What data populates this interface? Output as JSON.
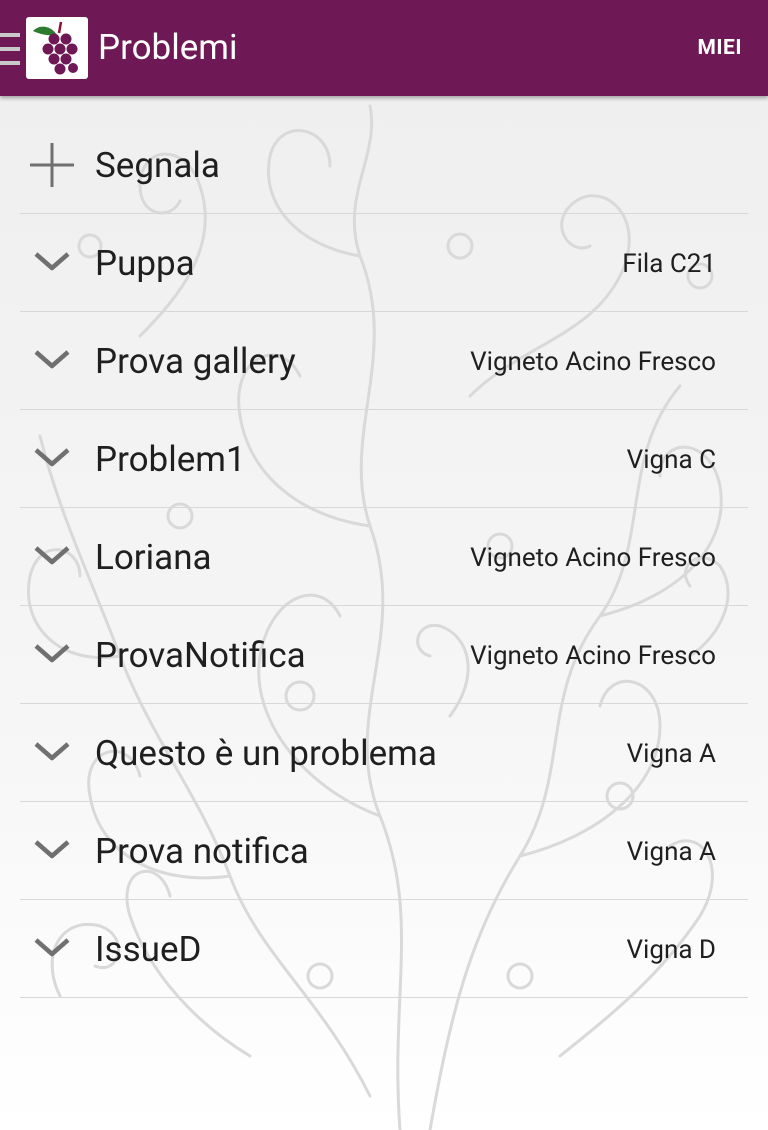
{
  "colors": {
    "app_bar": "#6e1955",
    "text": "#1f1f1f",
    "divider": "#d8d8d8"
  },
  "app_bar": {
    "drawer_icon": "hamburger-menu-icon",
    "logo_icon": "grape-logo-icon",
    "title": "Problemi",
    "action_label": "MIEI"
  },
  "report": {
    "icon": "plus-icon",
    "label": "Segnala"
  },
  "problems": [
    {
      "title": "Puppa",
      "location": "Fila C21"
    },
    {
      "title": "Prova gallery",
      "location": "Vigneto Acino Fresco"
    },
    {
      "title": "Problem1",
      "location": "Vigna C"
    },
    {
      "title": "Loriana",
      "location": "Vigneto Acino Fresco"
    },
    {
      "title": "ProvaNotifica",
      "location": "Vigneto Acino Fresco"
    },
    {
      "title": "Questo è un problema",
      "location": "Vigna A"
    },
    {
      "title": "Prova notifica",
      "location": "Vigna A"
    },
    {
      "title": "IssueD",
      "location": "Vigna D"
    }
  ],
  "row_icon": "chevron-down-icon"
}
